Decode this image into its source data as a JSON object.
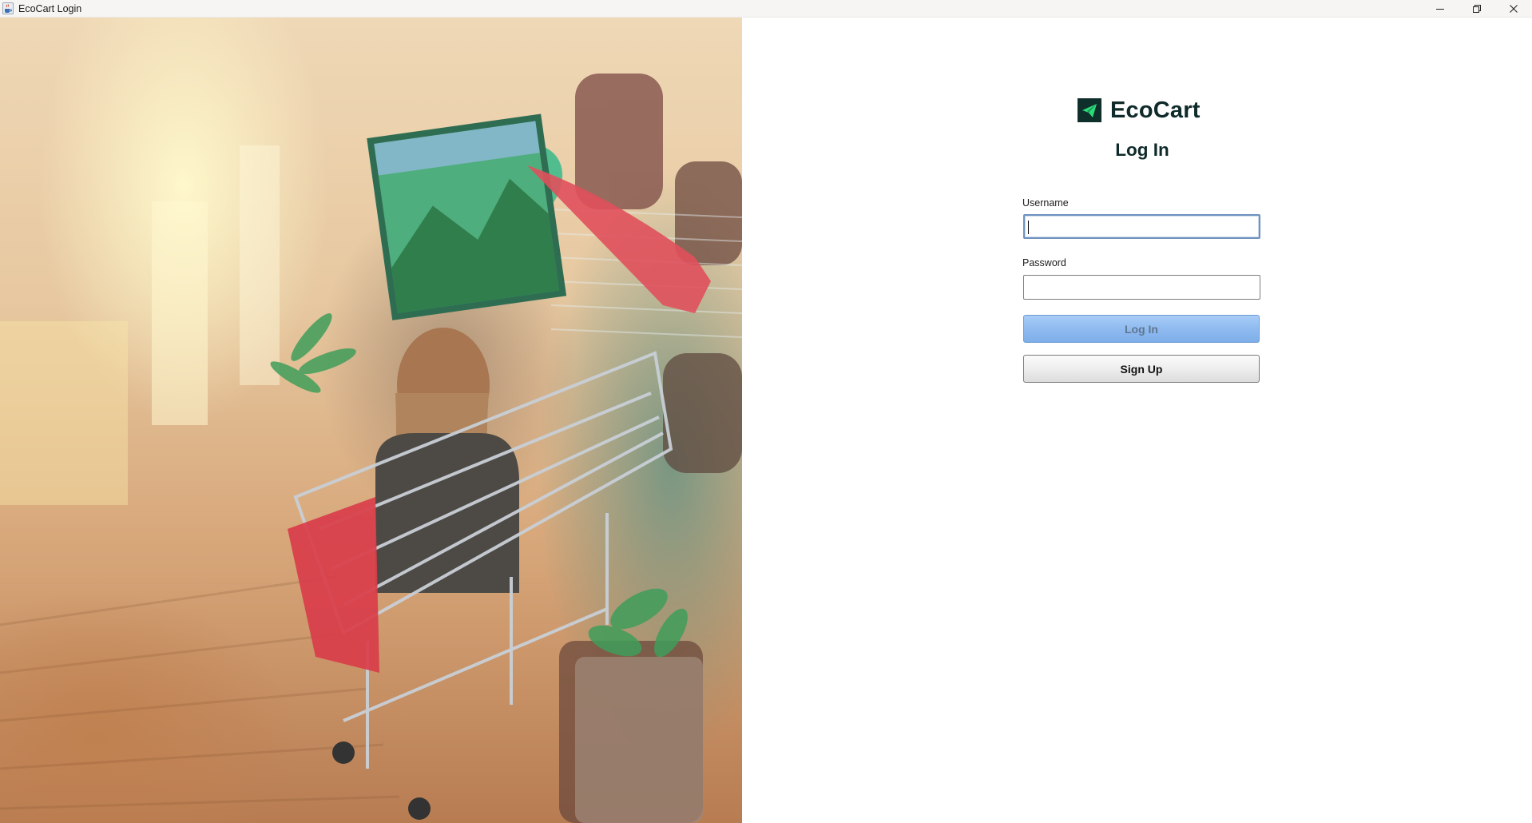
{
  "window": {
    "title": "EcoCart Login",
    "app_icon": "java-cup-icon",
    "controls": [
      "minimize-icon",
      "restore-icon",
      "close-icon"
    ]
  },
  "hero": {
    "image": "photo-woman-with-shopping-cart-among-plants"
  },
  "brand": {
    "name": "EcoCart",
    "logo_icon": "paper-plane-icon",
    "logo_bg": "#0f2f2b",
    "logo_accent": "#2bdc7a"
  },
  "form": {
    "title": "Log In",
    "username_label": "Username",
    "username_value": "",
    "password_label": "Password",
    "password_value": "",
    "login_button": "Log In",
    "signup_button": "Sign Up"
  },
  "colors": {
    "text_dark": "#0f2a2a",
    "login_button_bg": "#8fbbf0",
    "focus_border": "#6f93bd"
  }
}
